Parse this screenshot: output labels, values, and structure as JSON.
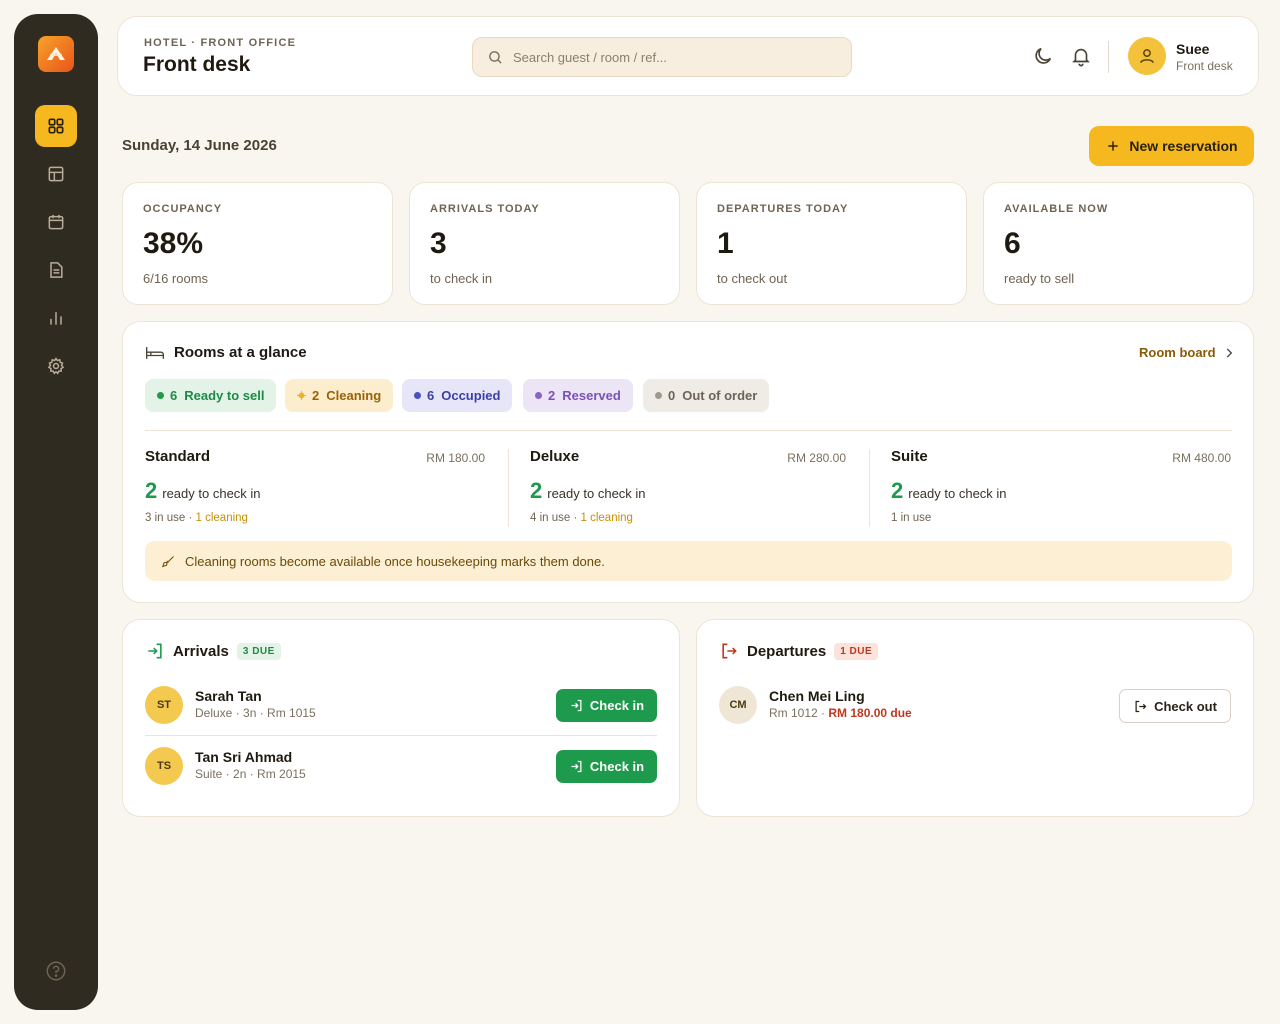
{
  "colors": {
    "accent": "#f6b81f",
    "sidebar": "#302b20",
    "success": "#1e9a4c",
    "danger": "#c0361e",
    "background": "#f9f6ef"
  },
  "sidebar": {
    "items": [
      {
        "icon": "grid-icon",
        "active": true
      },
      {
        "icon": "layout-icon",
        "active": false
      },
      {
        "icon": "calendar-icon",
        "active": false
      },
      {
        "icon": "document-icon",
        "active": false
      },
      {
        "icon": "bar-chart-icon",
        "active": false
      },
      {
        "icon": "gear-icon",
        "active": false
      }
    ],
    "help_icon": "help-icon"
  },
  "header": {
    "breadcrumb": "HOTEL · FRONT OFFICE",
    "title": "Front desk",
    "search_placeholder": "Search guest / room / ref...",
    "user_name": "Suee",
    "user_role": "Front desk"
  },
  "date": "Sunday, 14 June 2026",
  "new_reservation_label": "New reservation",
  "stats": [
    {
      "label": "OCCUPANCY",
      "value": "38%",
      "sub": "6/16 rooms"
    },
    {
      "label": "ARRIVALS TODAY",
      "value": "3",
      "sub": "to check in"
    },
    {
      "label": "DEPARTURES TODAY",
      "value": "1",
      "sub": "to check out"
    },
    {
      "label": "AVAILABLE NOW",
      "value": "6",
      "sub": "ready to sell"
    }
  ],
  "rooms": {
    "title": "Rooms at a glance",
    "board_link": "Room board",
    "chips": [
      {
        "count": "6",
        "label": "Ready to sell",
        "bg": "#e3f3e8",
        "fg": "#1e8a45",
        "dot": "#1e9a4c"
      },
      {
        "count": "2",
        "label": "Cleaning",
        "bg": "#fcedcd",
        "fg": "#9a6206",
        "dot": "#f0b21c"
      },
      {
        "count": "6",
        "label": "Occupied",
        "bg": "#e6e6f8",
        "fg": "#3c3fa8",
        "dot": "#4a4fc4"
      },
      {
        "count": "2",
        "label": "Reserved",
        "bg": "#ece5f6",
        "fg": "#7a52b8",
        "dot": "#8a62c8"
      },
      {
        "count": "0",
        "label": "Out of order",
        "bg": "#efece6",
        "fg": "#6b6458",
        "dot": "#a09a8e"
      }
    ],
    "types": [
      {
        "name": "Standard",
        "price": "RM 180.00",
        "ready": "2",
        "ready_text": "ready to check in",
        "in_use": "3 in use",
        "sep": " · ",
        "cleaning": "1 cleaning"
      },
      {
        "name": "Deluxe",
        "price": "RM 280.00",
        "ready": "2",
        "ready_text": "ready to check in",
        "in_use": "4 in use",
        "sep": " · ",
        "cleaning": "1 cleaning"
      },
      {
        "name": "Suite",
        "price": "RM 480.00",
        "ready": "2",
        "ready_text": "ready to check in",
        "in_use": "1 in use",
        "sep": "",
        "cleaning": ""
      }
    ],
    "note": "Cleaning rooms become available once housekeeping marks them done."
  },
  "arrivals": {
    "title": "Arrivals",
    "badge": "3 DUE",
    "button_label": "Check in",
    "guests": [
      {
        "initials": "ST",
        "name": "Sarah Tan",
        "detail": "Deluxe · 3n · Rm 1015"
      },
      {
        "initials": "TS",
        "name": "Tan Sri Ahmad",
        "detail": "Suite · 2n · Rm 2015"
      }
    ]
  },
  "departures": {
    "title": "Departures",
    "badge": "1 DUE",
    "button_label": "Check out",
    "guests": [
      {
        "initials": "CM",
        "name": "Chen Mei Ling",
        "detail": "Rm 1012 · ",
        "due": "RM 180.00 due"
      }
    ]
  }
}
